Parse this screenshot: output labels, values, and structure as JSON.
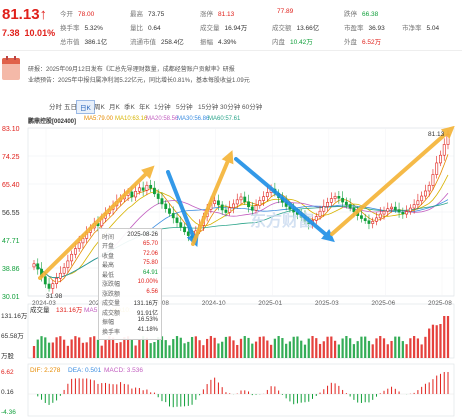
{
  "quote": {
    "price": "81.13",
    "change": "7.38",
    "change_pct": "10.01%",
    "row1": [
      {
        "k": "今开",
        "v": "78.00",
        "c": "red"
      },
      {
        "k": "最高",
        "v": "73.75",
        "c": "black"
      },
      {
        "k": "涨停",
        "v": "81.13",
        "c": "red"
      },
      {
        "k": "",
        "v": "77.89",
        "c": "red"
      },
      {
        "k": "跌停",
        "v": "66.38",
        "c": "green"
      }
    ],
    "row2": [
      {
        "k": "换手率",
        "v": "5.32%",
        "c": "black"
      },
      {
        "k": "量比",
        "v": "0.64",
        "c": "black"
      },
      {
        "k": "成交量",
        "v": "16.94万",
        "c": "black"
      },
      {
        "k": "成交额",
        "v": "13.66亿",
        "c": "black"
      },
      {
        "k": "市盈率",
        "v": "36.93",
        "c": "black"
      },
      {
        "k": "市净率",
        "v": "5.04",
        "c": "black"
      }
    ],
    "row3": [
      {
        "k": "总市值",
        "v": "386.1亿",
        "c": "black"
      },
      {
        "k": "流通市值",
        "v": "258.4亿",
        "c": "black"
      },
      {
        "k": "振幅",
        "v": "4.39%",
        "c": "black"
      },
      {
        "k": "内盘",
        "v": "10.42万",
        "c": "green"
      },
      {
        "k": "外盘",
        "v": "6.52万",
        "c": "red"
      }
    ]
  },
  "notice": {
    "line1": "研报：2025年09月12日发布《汇总先导理财数量，成都经营账户贡献率》研报",
    "line2": "业绩预告：2025年中报归属净利润5.22亿元，同比增长0.81%，基本每股收益1.09元"
  },
  "tabs": [
    "分时",
    "五日",
    "日K",
    "周K",
    "月K",
    "季K",
    "年K",
    "1分钟",
    "5分钟",
    "15分钟",
    "30分钟",
    "60分钟"
  ],
  "active_tab": "日K",
  "ma_legend": {
    "stock": "鹏鼎控股[002400]",
    "items": [
      {
        "name": "MA5:79.00",
        "color": "#e68a00"
      },
      {
        "name": "MA10:63.16",
        "color": "#d7b300"
      },
      {
        "name": "MA20:58.56",
        "color": "#c25fc0"
      },
      {
        "name": "MA30:56.86",
        "color": "#3b8de0"
      },
      {
        "name": "MA60:57.61",
        "color": "#2aa48a"
      }
    ]
  },
  "tooltip": {
    "date_label": "时间",
    "date": "2025-08-26",
    "rows": [
      {
        "k": "开盘",
        "v": "65.70",
        "c": "red"
      },
      {
        "k": "收盘",
        "v": "72.06",
        "c": "red"
      },
      {
        "k": "最高",
        "v": "75.80",
        "c": "red"
      },
      {
        "k": "最低",
        "v": "64.91",
        "c": "green"
      },
      {
        "k": "涨跌幅",
        "v": "10.00%",
        "c": "red"
      },
      {
        "k": "涨跌额",
        "v": "6.56",
        "c": "red"
      },
      {
        "k": "成交量",
        "v": "131.16万",
        "c": "black"
      },
      {
        "k": "成交额",
        "v": "91.91亿",
        "c": "black"
      },
      {
        "k": "振幅",
        "v": "16.53%",
        "c": "black"
      },
      {
        "k": "换手率",
        "v": "41.18%",
        "c": "black"
      }
    ]
  },
  "watermark": "东方财富",
  "price_axis": [
    "83.10",
    "74.25",
    "65.40",
    "56.55",
    "47.71",
    "38.86",
    "30.01"
  ],
  "date_axis": [
    "2024-03",
    "2024-06",
    "2024-08",
    "2024-10",
    "2025-01",
    "2025-03",
    "2025-06",
    "2025-08"
  ],
  "annotations": {
    "min_price": "31.98",
    "max_price": "81.13"
  },
  "volume_legend": {
    "label": "成交量",
    "values": [
      "131.16万",
      "MA5:",
      "MA10:"
    ]
  },
  "volume_axis": [
    "131.16万",
    "65.58万",
    "万股"
  ],
  "macd_legend": {
    "dif": "DIF: 2.278",
    "dea": "DEA: 0.501",
    "macd": "MACD: 3.536"
  },
  "macd_axis": [
    "6.62",
    "0.16",
    "-4.36"
  ],
  "chart_data": {
    "type": "candlestick",
    "title": "鹏鼎控股[002400]",
    "ylim": [
      30.01,
      83.1
    ],
    "x_ticks": [
      "2024-03",
      "2024-06",
      "2024-08",
      "2024-10",
      "2025-01",
      "2025-03",
      "2025-06",
      "2025-08"
    ],
    "close": [
      40.2,
      38.5,
      36.1,
      33.8,
      32.4,
      33.9,
      35.6,
      37.2,
      39.0,
      41.1,
      43.2,
      45.0,
      46.8,
      48.2,
      50.1,
      51.5,
      53.0,
      52.2,
      54.6,
      56.1,
      57.4,
      58.5,
      59.9,
      60.7,
      61.8,
      62.9,
      61.3,
      63.1,
      64.2,
      63.4,
      65.0,
      64.1,
      62.3,
      60.8,
      59.1,
      57.6,
      56.1,
      54.7,
      53.2,
      51.8,
      50.3,
      49.1,
      48.4,
      50.6,
      52.3,
      55.1,
      57.4,
      59.2,
      60.1,
      58.8,
      57.2,
      56.4,
      57.9,
      59.1,
      60.4,
      61.3,
      59.8,
      58.2,
      57.1,
      58.6,
      60.2,
      61.4,
      62.7,
      63.8,
      62.5,
      61.1,
      59.6,
      58.3,
      57.4,
      56.5,
      55.8,
      54.9,
      53.7,
      52.8,
      53.9,
      55.1,
      56.8,
      58.3,
      59.6,
      60.8,
      61.5,
      60.9,
      59.7,
      58.9,
      57.8,
      56.6,
      55.4,
      54.5,
      53.8,
      52.9,
      53.6,
      54.7,
      55.9,
      56.8,
      57.6,
      58.1,
      57.3,
      56.5,
      55.9,
      56.7,
      57.8,
      58.9,
      60.1,
      61.6,
      63.2,
      65.0,
      68.4,
      72.06,
      74.5,
      77.89,
      81.13
    ]
  }
}
